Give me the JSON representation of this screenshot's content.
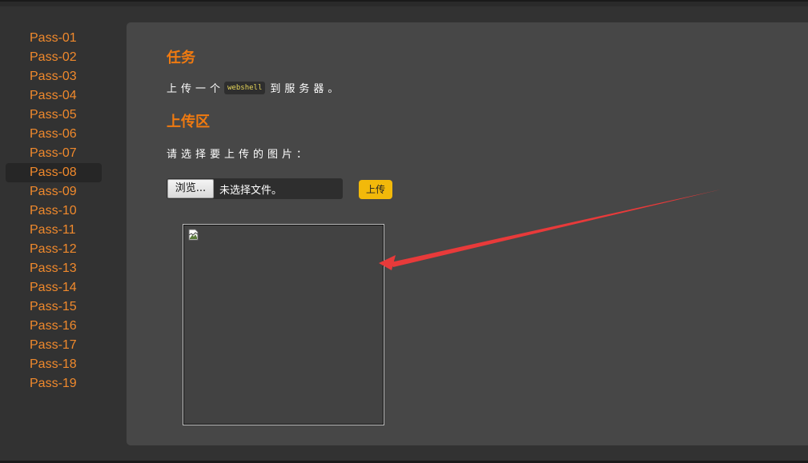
{
  "sidebar": {
    "items": [
      {
        "label": "Pass-01"
      },
      {
        "label": "Pass-02"
      },
      {
        "label": "Pass-03"
      },
      {
        "label": "Pass-04"
      },
      {
        "label": "Pass-05"
      },
      {
        "label": "Pass-06"
      },
      {
        "label": "Pass-07"
      },
      {
        "label": "Pass-08"
      },
      {
        "label": "Pass-09"
      },
      {
        "label": "Pass-10"
      },
      {
        "label": "Pass-11"
      },
      {
        "label": "Pass-12"
      },
      {
        "label": "Pass-13"
      },
      {
        "label": "Pass-14"
      },
      {
        "label": "Pass-15"
      },
      {
        "label": "Pass-16"
      },
      {
        "label": "Pass-17"
      },
      {
        "label": "Pass-18"
      },
      {
        "label": "Pass-19"
      }
    ],
    "active": "Pass-08"
  },
  "task": {
    "heading": "任务",
    "text_before": "上传一个",
    "code": "webshell",
    "text_after": "到服务器。"
  },
  "upload": {
    "heading": "上传区",
    "prompt": "请选择要上传的图片：",
    "browse_label": "浏览...",
    "file_status": "未选择文件。",
    "submit_label": "上传"
  },
  "preview": {
    "icon": "broken-image-icon"
  },
  "annotation": {
    "icon": "red-arrow-icon",
    "color": "#e83a3a"
  },
  "colors": {
    "accent": "#f07a10",
    "sidebar_link": "#f0892c",
    "button": "#f2b90a",
    "code_text": "#e8d85a"
  }
}
